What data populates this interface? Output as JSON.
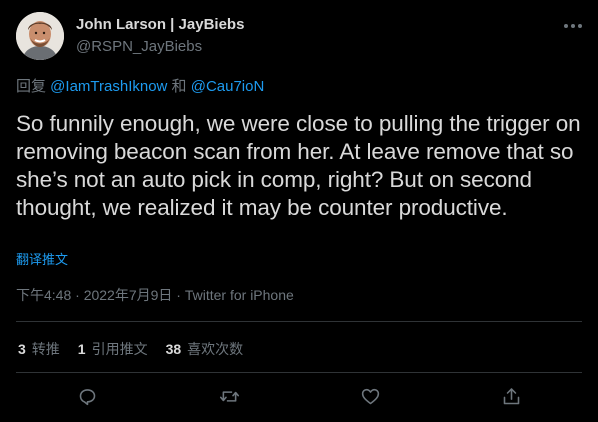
{
  "author": {
    "display_name": "John Larson | JayBiebs",
    "handle": "@RSPN_JayBiebs"
  },
  "reply": {
    "prefix": "回复 ",
    "mention1": "@IamTrashIknow",
    "connector": " 和 ",
    "mention2": "@Cau7ioN"
  },
  "tweet": {
    "text": "So funnily enough, we were close to pulling the trigger on removing beacon scan from her. At leave remove that so she’s not an auto pick in comp, right? But on second thought, we realized it may be counter productive.",
    "translate_label": "翻译推文",
    "timestamp": "下午4:48 · 2022年7月9日 · Twitter for iPhone"
  },
  "stats": {
    "retweets_count": "3",
    "retweets_label": "转推",
    "quotes_count": "1",
    "quotes_label": "引用推文",
    "likes_count": "38",
    "likes_label": "喜欢次数"
  },
  "icons": {
    "more": "more-horizontal-icon",
    "reply": "reply-icon",
    "retweet": "retweet-icon",
    "like": "heart-icon",
    "share": "share-icon"
  },
  "colors": {
    "background": "#000000",
    "text": "#d9d9d9",
    "secondary": "#6e767d",
    "accent": "#1d9bf0",
    "divider": "#2f3336"
  }
}
